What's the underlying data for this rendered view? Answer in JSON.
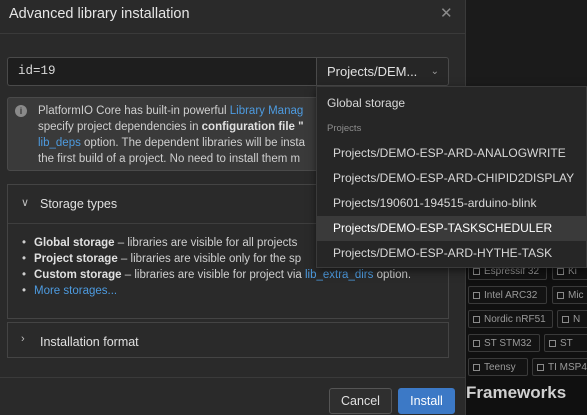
{
  "dialog": {
    "title": "Advanced library installation",
    "close_glyph": "✕",
    "query_value": "id=19",
    "storage_select": {
      "selected": "Projects/DEM...",
      "chevron": "⌄"
    },
    "info": {
      "icon": "i",
      "l1a": "PlatformIO Core has built-in powerful ",
      "l1b": "Library Manag",
      "l2a": "specify project dependencies in ",
      "l2b": "configuration file \"",
      "l3a": "lib_deps",
      "l3b": " option. The dependent libraries will be insta",
      "l4": "the first build of a project. No need to install them m"
    },
    "storage_types": {
      "arrow": "∨",
      "label": "Storage types",
      "items": [
        {
          "name": "Global storage",
          "text": " – libraries are visible for all projects"
        },
        {
          "name": "Project storage",
          "text": " – libraries are visible only for the sp"
        },
        {
          "name": "Custom storage",
          "text": " – libraries are visible for project via ",
          "link": "lib_extra_dirs",
          "tail": " option."
        }
      ],
      "more": "More storages..."
    },
    "installation_format": {
      "arrow": "›",
      "label": "Installation format"
    },
    "cancel_label": "Cancel",
    "install_label": "Install"
  },
  "dropdown": {
    "global": "Global storage",
    "group": "Projects",
    "projects": [
      "Projects/DEMO-ESP-ARD-ANALOGWRITE",
      "Projects/DEMO-ESP-ARD-CHIPID2DISPLAY",
      "Projects/190601-194515-arduino-blink",
      "Projects/DEMO-ESP-TASKSCHEDULER",
      "Projects/DEMO-ESP-ARD-HYTHE-TASK"
    ],
    "selected_index": 3
  },
  "background": {
    "chips": [
      "Espressif 32",
      "Ki",
      "Intel ARC32",
      "Mic",
      "Nordic nRF51",
      "N",
      "ST STM32",
      "ST",
      "Teensy",
      "TI MSP4"
    ],
    "heading": "Frameworks"
  }
}
